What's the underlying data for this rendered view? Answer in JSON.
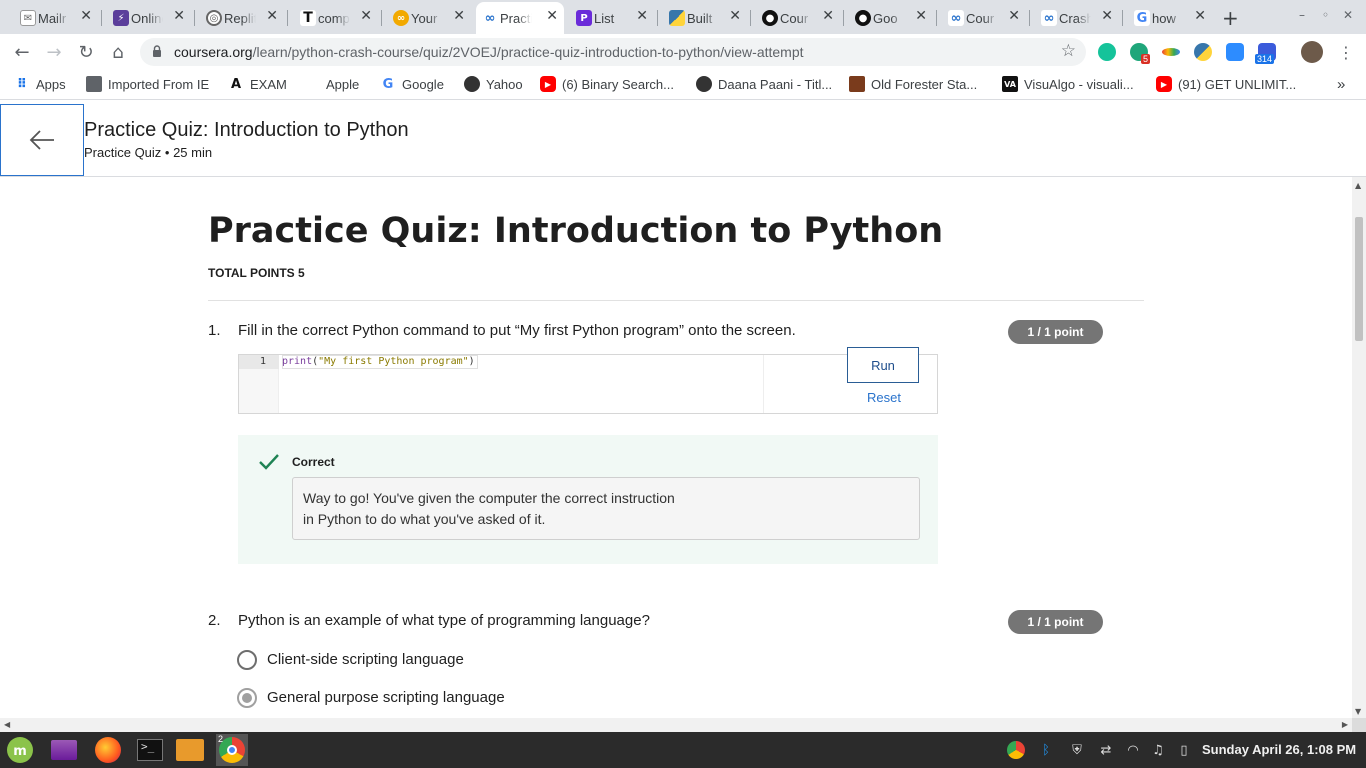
{
  "browser": {
    "tabs": [
      {
        "title": "Mailr",
        "icon": "mail-icon",
        "color": "#888888"
      },
      {
        "title": "Online",
        "icon": "bolt-icon",
        "color": "#5b3e9b"
      },
      {
        "title": "Replit",
        "icon": "replit-icon",
        "color": "#555555"
      },
      {
        "title": "comp",
        "icon": "t-icon",
        "color": "#111111"
      },
      {
        "title": "Your",
        "icon": "colab-icon",
        "color": "#f2a900"
      },
      {
        "title": "Practice",
        "icon": "coursera-icon",
        "color": "#2a73cc"
      },
      {
        "title": "List",
        "icon": "p-icon",
        "color": "#6a2bd9"
      },
      {
        "title": "Built",
        "icon": "python-icon",
        "color": "#3776ab"
      },
      {
        "title": "Cour",
        "icon": "github-icon",
        "color": "#111111"
      },
      {
        "title": "Goo",
        "icon": "github-icon",
        "color": "#111111"
      },
      {
        "title": "Cour",
        "icon": "coursera-icon",
        "color": "#2a73cc"
      },
      {
        "title": "Crash",
        "icon": "coursera-icon",
        "color": "#2a73cc"
      },
      {
        "title": "how",
        "icon": "google-icon",
        "color": "#4285f4"
      }
    ],
    "url_host": "coursera.org",
    "url_path": "/learn/python-crash-course/quiz/2VOEJ/practice-quiz-introduction-to-python/view-attempt",
    "extension_badges": {
      "badge1": "5",
      "badge2": "314"
    },
    "bookmarks": [
      {
        "label": "Apps",
        "icon": "apps-grid-icon"
      },
      {
        "label": "Imported From IE",
        "icon": "folder-icon"
      },
      {
        "label": "EXAM",
        "icon": "a-icon"
      },
      {
        "label": "Apple",
        "icon": "apple-icon"
      },
      {
        "label": "Google",
        "icon": "google-icon"
      },
      {
        "label": "Yahoo",
        "icon": "globe-icon"
      },
      {
        "label": "(6) Binary Search...",
        "icon": "youtube-icon"
      },
      {
        "label": "Daana Paani - Titl...",
        "icon": "globe-icon"
      },
      {
        "label": "Old Forester Sta...",
        "icon": "bottle-icon"
      },
      {
        "label": "VisuAlgo - visuali...",
        "icon": "va-icon"
      },
      {
        "label": "(91) GET UNLIMIT...",
        "icon": "youtube-icon"
      }
    ],
    "bookmarks_more": "»"
  },
  "header": {
    "title": "Practice Quiz: Introduction to Python",
    "subtitle": "Practice Quiz • 25 min"
  },
  "quiz": {
    "title": "Practice Quiz: Introduction to Python",
    "total_points": "TOTAL POINTS 5",
    "questions": [
      {
        "number": "1.",
        "text": "Fill in the correct Python command to put “My first Python program” onto the screen.",
        "points": "1 / 1 point",
        "code_line_number": "1",
        "code": {
          "fn": "print",
          "open": "(",
          "str": "\"My first Python program\"",
          "close": ")"
        },
        "run_label": "Run",
        "reset_label": "Reset",
        "feedback_label": "Correct",
        "feedback_line1": "Way to go! You've given the computer the correct instruction",
        "feedback_line2": "in Python to do what you've asked of it."
      },
      {
        "number": "2.",
        "text": "Python is an example of what type of programming language?",
        "points": "1 / 1 point",
        "options": [
          {
            "label": "Client-side scripting language",
            "selected": false
          },
          {
            "label": "General purpose scripting language",
            "selected": true
          }
        ]
      }
    ]
  },
  "taskbar": {
    "chrome_badge": "2",
    "clock": "Sunday April 26, 1:08 PM"
  },
  "colors": {
    "accent": "#2a73cc",
    "points_pill": "#757575",
    "feedback_bg": "#f1f9f5",
    "check": "#1f8354"
  }
}
